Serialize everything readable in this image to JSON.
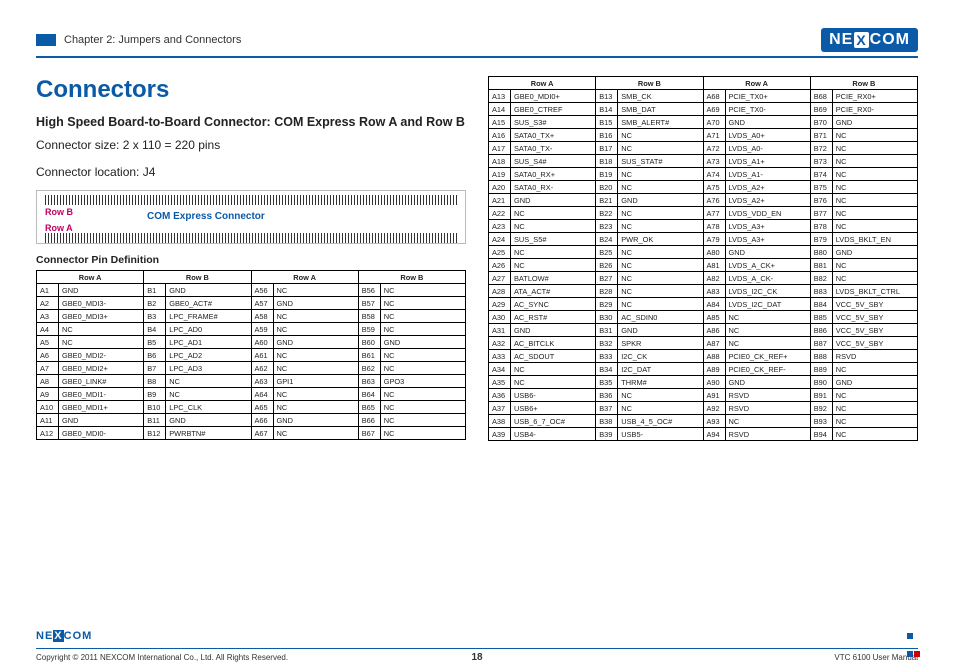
{
  "header": {
    "chapter": "Chapter 2: Jumpers and Connectors",
    "brand": "NEXCOM"
  },
  "title": "Connectors",
  "subtitle_bold": "High Speed Board-to-Board Connector: COM Express Row A and Row B",
  "conn_size": "Connector size: 2 x 110 = 220 pins",
  "conn_loc": "Connector location: J4",
  "diagram": {
    "rowB": "Row B",
    "rowA": "Row A",
    "label": "COM Express Connector"
  },
  "pindef_hdr": "Connector Pin Definition",
  "th": {
    "rowA": "Row A",
    "rowB": "Row B"
  },
  "chart_data": {
    "type": "table",
    "title": "Connector Pin Definition — COM Express Row A and Row B",
    "columns": [
      "Row A pin",
      "Row A signal",
      "Row B pin",
      "Row B signal",
      "Row A pin",
      "Row A signal",
      "Row B pin",
      "Row B signal"
    ],
    "left_block": [
      [
        "A1",
        "GND",
        "B1",
        "GND",
        "A56",
        "NC",
        "B56",
        "NC"
      ],
      [
        "A2",
        "GBE0_MDI3-",
        "B2",
        "GBE0_ACT#",
        "A57",
        "GND",
        "B57",
        "NC"
      ],
      [
        "A3",
        "GBE0_MDI3+",
        "B3",
        "LPC_FRAME#",
        "A58",
        "NC",
        "B58",
        "NC"
      ],
      [
        "A4",
        "NC",
        "B4",
        "LPC_AD0",
        "A59",
        "NC",
        "B59",
        "NC"
      ],
      [
        "A5",
        "NC",
        "B5",
        "LPC_AD1",
        "A60",
        "GND",
        "B60",
        "GND"
      ],
      [
        "A6",
        "GBE0_MDI2-",
        "B6",
        "LPC_AD2",
        "A61",
        "NC",
        "B61",
        "NC"
      ],
      [
        "A7",
        "GBE0_MDI2+",
        "B7",
        "LPC_AD3",
        "A62",
        "NC",
        "B62",
        "NC"
      ],
      [
        "A8",
        "GBE0_LINK#",
        "B8",
        "NC",
        "A63",
        "GPI1",
        "B63",
        "GPO3"
      ],
      [
        "A9",
        "GBE0_MDI1-",
        "B9",
        "NC",
        "A64",
        "NC",
        "B64",
        "NC"
      ],
      [
        "A10",
        "GBE0_MDI1+",
        "B10",
        "LPC_CLK",
        "A65",
        "NC",
        "B65",
        "NC"
      ],
      [
        "A11",
        "GND",
        "B11",
        "GND",
        "A66",
        "GND",
        "B66",
        "NC"
      ],
      [
        "A12",
        "GBE0_MDI0-",
        "B12",
        "PWRBTN#",
        "A67",
        "NC",
        "B67",
        "NC"
      ]
    ],
    "right_block": [
      [
        "A13",
        "GBE0_MDI0+",
        "B13",
        "SMB_CK",
        "A68",
        "PCIE_TX0+",
        "B68",
        "PCIE_RX0+"
      ],
      [
        "A14",
        "GBE0_CTREF",
        "B14",
        "SMB_DAT",
        "A69",
        "PCIE_TX0-",
        "B69",
        "PCIE_RX0-"
      ],
      [
        "A15",
        "SUS_S3#",
        "B15",
        "SMB_ALERT#",
        "A70",
        "GND",
        "B70",
        "GND"
      ],
      [
        "A16",
        "SATA0_TX+",
        "B16",
        "NC",
        "A71",
        "LVDS_A0+",
        "B71",
        "NC"
      ],
      [
        "A17",
        "SATA0_TX-",
        "B17",
        "NC",
        "A72",
        "LVDS_A0-",
        "B72",
        "NC"
      ],
      [
        "A18",
        "SUS_S4#",
        "B18",
        "SUS_STAT#",
        "A73",
        "LVDS_A1+",
        "B73",
        "NC"
      ],
      [
        "A19",
        "SATA0_RX+",
        "B19",
        "NC",
        "A74",
        "LVDS_A1-",
        "B74",
        "NC"
      ],
      [
        "A20",
        "SATA0_RX-",
        "B20",
        "NC",
        "A75",
        "LVDS_A2+",
        "B75",
        "NC"
      ],
      [
        "A21",
        "GND",
        "B21",
        "GND",
        "A76",
        "LVDS_A2+",
        "B76",
        "NC"
      ],
      [
        "A22",
        "NC",
        "B22",
        "NC",
        "A77",
        "LVDS_VDD_EN",
        "B77",
        "NC"
      ],
      [
        "A23",
        "NC",
        "B23",
        "NC",
        "A78",
        "LVDS_A3+",
        "B78",
        "NC"
      ],
      [
        "A24",
        "SUS_S5#",
        "B24",
        "PWR_OK",
        "A79",
        "LVDS_A3+",
        "B79",
        "LVDS_BKLT_EN"
      ],
      [
        "A25",
        "NC",
        "B25",
        "NC",
        "A80",
        "GND",
        "B80",
        "GND"
      ],
      [
        "A26",
        "NC",
        "B26",
        "NC",
        "A81",
        "LVDS_A_CK+",
        "B81",
        "NC"
      ],
      [
        "A27",
        "BATLOW#",
        "B27",
        "NC",
        "A82",
        "LVDS_A_CK-",
        "B82",
        "NC"
      ],
      [
        "A28",
        "ATA_ACT#",
        "B28",
        "NC",
        "A83",
        "LVDS_I2C_CK",
        "B83",
        "LVDS_BKLT_CTRL"
      ],
      [
        "A29",
        "AC_SYNC",
        "B29",
        "NC",
        "A84",
        "LVDS_I2C_DAT",
        "B84",
        "VCC_5V_SBY"
      ],
      [
        "A30",
        "AC_RST#",
        "B30",
        "AC_SDIN0",
        "A85",
        "NC",
        "B85",
        "VCC_5V_SBY"
      ],
      [
        "A31",
        "GND",
        "B31",
        "GND",
        "A86",
        "NC",
        "B86",
        "VCC_5V_SBY"
      ],
      [
        "A32",
        "AC_BITCLK",
        "B32",
        "SPKR",
        "A87",
        "NC",
        "B87",
        "VCC_5V_SBY"
      ],
      [
        "A33",
        "AC_SDOUT",
        "B33",
        "I2C_CK",
        "A88",
        "PCIE0_CK_REF+",
        "B88",
        "RSVD"
      ],
      [
        "A34",
        "NC",
        "B34",
        "I2C_DAT",
        "A89",
        "PCIE0_CK_REF-",
        "B89",
        "NC"
      ],
      [
        "A35",
        "NC",
        "B35",
        "THRM#",
        "A90",
        "GND",
        "B90",
        "GND"
      ],
      [
        "A36",
        "USB6-",
        "B36",
        "NC",
        "A91",
        "RSVD",
        "B91",
        "NC"
      ],
      [
        "A37",
        "USB6+",
        "B37",
        "NC",
        "A92",
        "RSVD",
        "B92",
        "NC"
      ],
      [
        "A38",
        "USB_6_7_OC#",
        "B38",
        "USB_4_5_OC#",
        "A93",
        "NC",
        "B93",
        "NC"
      ],
      [
        "A39",
        "USB4-",
        "B39",
        "USB5-",
        "A94",
        "RSVD",
        "B94",
        "NC"
      ]
    ]
  },
  "footer": {
    "flogo": "NEXCOM",
    "copyright": "Copyright © 2011 NEXCOM International Co., Ltd. All Rights Reserved.",
    "page": "18",
    "manual": "VTC 6100 User Manual"
  }
}
